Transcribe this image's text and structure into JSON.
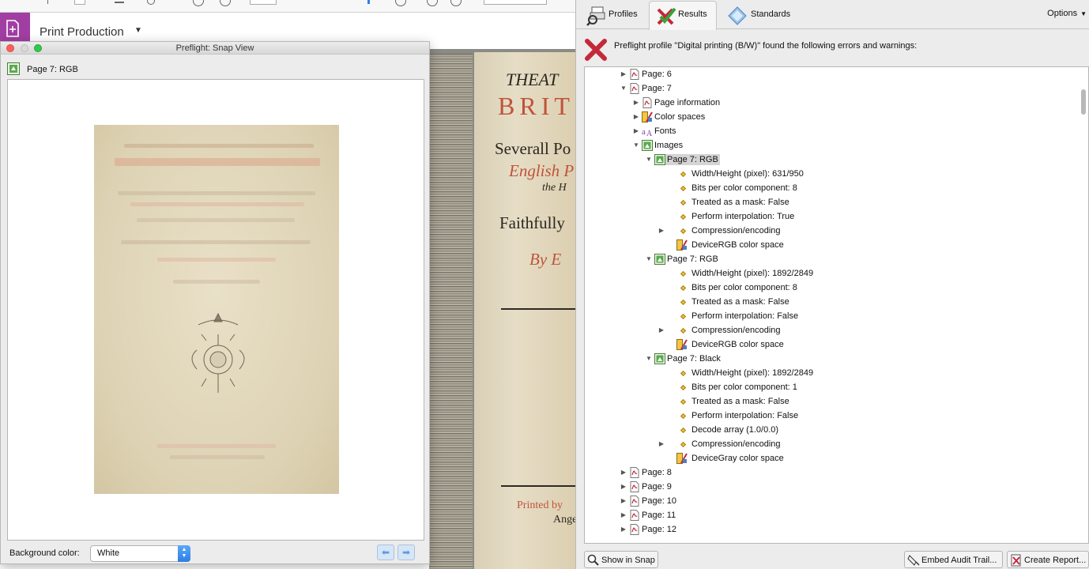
{
  "app": {
    "title": "Print Production"
  },
  "snap_window": {
    "title": "Preflight: Snap View",
    "subhead": "Page 7: RGB",
    "background_label": "Background color:",
    "background_value": "White",
    "prev_icon": "arrow-left-icon",
    "next_icon": "arrow-right-icon"
  },
  "preflight": {
    "tabs": [
      {
        "label": "Profiles",
        "icon": "profiles-icon"
      },
      {
        "label": "Results",
        "icon": "results-icon"
      },
      {
        "label": "Standards",
        "icon": "standards-icon"
      }
    ],
    "options_label": "Options",
    "summary": "Preflight profile \"Digital printing (B/W)\" found the following errors and warnings:",
    "tree": [
      {
        "label": "Page: 6",
        "icon": "pdf-page-icon",
        "level": 0,
        "disclosure": "collapsed"
      },
      {
        "label": "Page: 7",
        "icon": "pdf-page-icon",
        "level": 0,
        "disclosure": "expanded"
      },
      {
        "label": "Page information",
        "icon": "pdf-page-icon",
        "level": 1,
        "disclosure": "collapsed"
      },
      {
        "label": "Color spaces",
        "icon": "color-space-icon",
        "level": 1,
        "disclosure": "collapsed"
      },
      {
        "label": "Fonts",
        "icon": "fonts-icon",
        "level": 1,
        "disclosure": "collapsed"
      },
      {
        "label": "Images",
        "icon": "image-icon",
        "level": 1,
        "disclosure": "expanded"
      },
      {
        "label": "Page 7: RGB",
        "icon": "image-icon",
        "level": 2,
        "disclosure": "expanded",
        "selected": true
      },
      {
        "label": "Width/Height (pixel): 631/950",
        "icon": "property-diamond-icon",
        "level": 3,
        "disclosure": "none"
      },
      {
        "label": "Bits per color component: 8",
        "icon": "property-diamond-icon",
        "level": 3,
        "disclosure": "none"
      },
      {
        "label": "Treated as a mask: False",
        "icon": "property-diamond-icon",
        "level": 3,
        "disclosure": "none"
      },
      {
        "label": "Perform interpolation: True",
        "icon": "property-diamond-icon",
        "level": 3,
        "disclosure": "none"
      },
      {
        "label": "Compression/encoding",
        "icon": "property-diamond-icon",
        "level": 3,
        "disclosure": "collapsed"
      },
      {
        "label": "DeviceRGB color space",
        "icon": "color-space-icon",
        "level": 3,
        "disclosure": "none"
      },
      {
        "label": "Page 7: RGB",
        "icon": "image-icon",
        "level": 2,
        "disclosure": "expanded"
      },
      {
        "label": "Width/Height (pixel): 1892/2849",
        "icon": "property-diamond-icon",
        "level": 3,
        "disclosure": "none"
      },
      {
        "label": "Bits per color component: 8",
        "icon": "property-diamond-icon",
        "level": 3,
        "disclosure": "none"
      },
      {
        "label": "Treated as a mask: False",
        "icon": "property-diamond-icon",
        "level": 3,
        "disclosure": "none"
      },
      {
        "label": "Perform interpolation: False",
        "icon": "property-diamond-icon",
        "level": 3,
        "disclosure": "none"
      },
      {
        "label": "Compression/encoding",
        "icon": "property-diamond-icon",
        "level": 3,
        "disclosure": "collapsed"
      },
      {
        "label": "DeviceRGB color space",
        "icon": "color-space-icon",
        "level": 3,
        "disclosure": "none"
      },
      {
        "label": "Page 7: Black",
        "icon": "image-icon",
        "level": 2,
        "disclosure": "expanded"
      },
      {
        "label": "Width/Height (pixel): 1892/2849",
        "icon": "property-diamond-icon",
        "level": 3,
        "disclosure": "none"
      },
      {
        "label": "Bits per color component: 1",
        "icon": "property-diamond-icon",
        "level": 3,
        "disclosure": "none"
      },
      {
        "label": "Treated as a mask: False",
        "icon": "property-diamond-icon",
        "level": 3,
        "disclosure": "none"
      },
      {
        "label": "Perform interpolation: False",
        "icon": "property-diamond-icon",
        "level": 3,
        "disclosure": "none"
      },
      {
        "label": "Decode array (1.0/0.0)",
        "icon": "property-diamond-icon",
        "level": 3,
        "disclosure": "none"
      },
      {
        "label": "Compression/encoding",
        "icon": "property-diamond-icon",
        "level": 3,
        "disclosure": "collapsed"
      },
      {
        "label": "DeviceGray color space",
        "icon": "color-space-icon",
        "level": 3,
        "disclosure": "none"
      },
      {
        "label": "Page: 8",
        "icon": "pdf-page-icon",
        "level": 0,
        "disclosure": "collapsed"
      },
      {
        "label": "Page: 9",
        "icon": "pdf-page-icon",
        "level": 0,
        "disclosure": "collapsed"
      },
      {
        "label": "Page: 10",
        "icon": "pdf-page-icon",
        "level": 0,
        "disclosure": "collapsed"
      },
      {
        "label": "Page: 11",
        "icon": "pdf-page-icon",
        "level": 0,
        "disclosure": "collapsed"
      },
      {
        "label": "Page: 12",
        "icon": "pdf-page-icon",
        "level": 0,
        "disclosure": "collapsed"
      }
    ],
    "buttons": {
      "show_in_snap": "Show in Snap",
      "embed_audit": "Embed Audit Trail...",
      "create_report": "Create Report..."
    }
  },
  "book": {
    "lines": [
      "THEAT",
      "BRIT",
      "Severall Po",
      "English P",
      "the H",
      "Faithfully",
      "By E",
      "Printed by",
      "Ange"
    ]
  },
  "colors": {
    "accent": "#a13ea3",
    "error_red": "#c4283a",
    "selection": "#d4d4d4",
    "link_blue": "#2d7ee6"
  }
}
